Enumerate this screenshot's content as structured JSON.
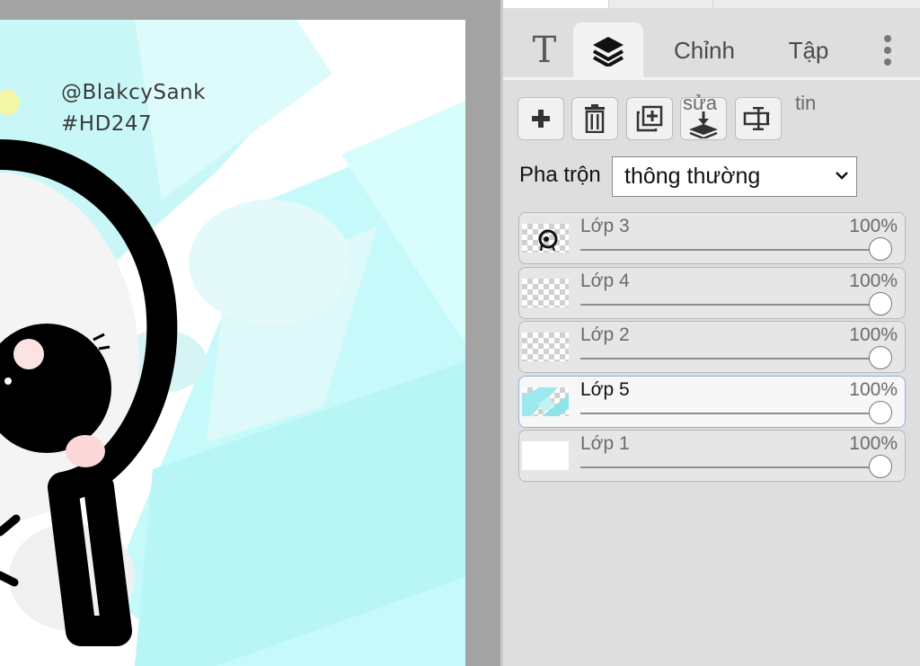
{
  "canvas": {
    "watermark_line1": "@BlakcySank",
    "watermark_line2": "#HD247"
  },
  "tabs": {
    "text_label": "T",
    "layers_icon": "layers-icon",
    "adjust_label": "Chỉnh",
    "set_label": "Tập",
    "more_icon": "more-vertical-icon"
  },
  "toolbar": {
    "add_icon": "plus-icon",
    "delete_icon": "trash-icon",
    "duplicate_icon": "duplicate-icon",
    "merge_icon": "merge-down-icon",
    "merge_label": "sửa",
    "properties_icon": "properties-icon",
    "info_label": "tin"
  },
  "blend": {
    "label": "Pha trộn",
    "selected": "thông thường"
  },
  "layers": [
    {
      "name": "Lớp 3",
      "opacity": "100%",
      "opacity_value": 1.0,
      "active": false
    },
    {
      "name": "Lớp 4",
      "opacity": "100%",
      "opacity_value": 1.0,
      "active": false
    },
    {
      "name": "Lớp 2",
      "opacity": "100%",
      "opacity_value": 1.0,
      "active": false
    },
    {
      "name": "Lớp 5",
      "opacity": "100%",
      "opacity_value": 1.0,
      "active": true
    },
    {
      "name": "Lớp 1",
      "opacity": "100%",
      "opacity_value": 1.0,
      "active": false
    }
  ],
  "colors": {
    "panel_bg": "#dedede",
    "canvas_accent": "#c8fbfb",
    "active_layer_border": "#8fb0e8"
  }
}
